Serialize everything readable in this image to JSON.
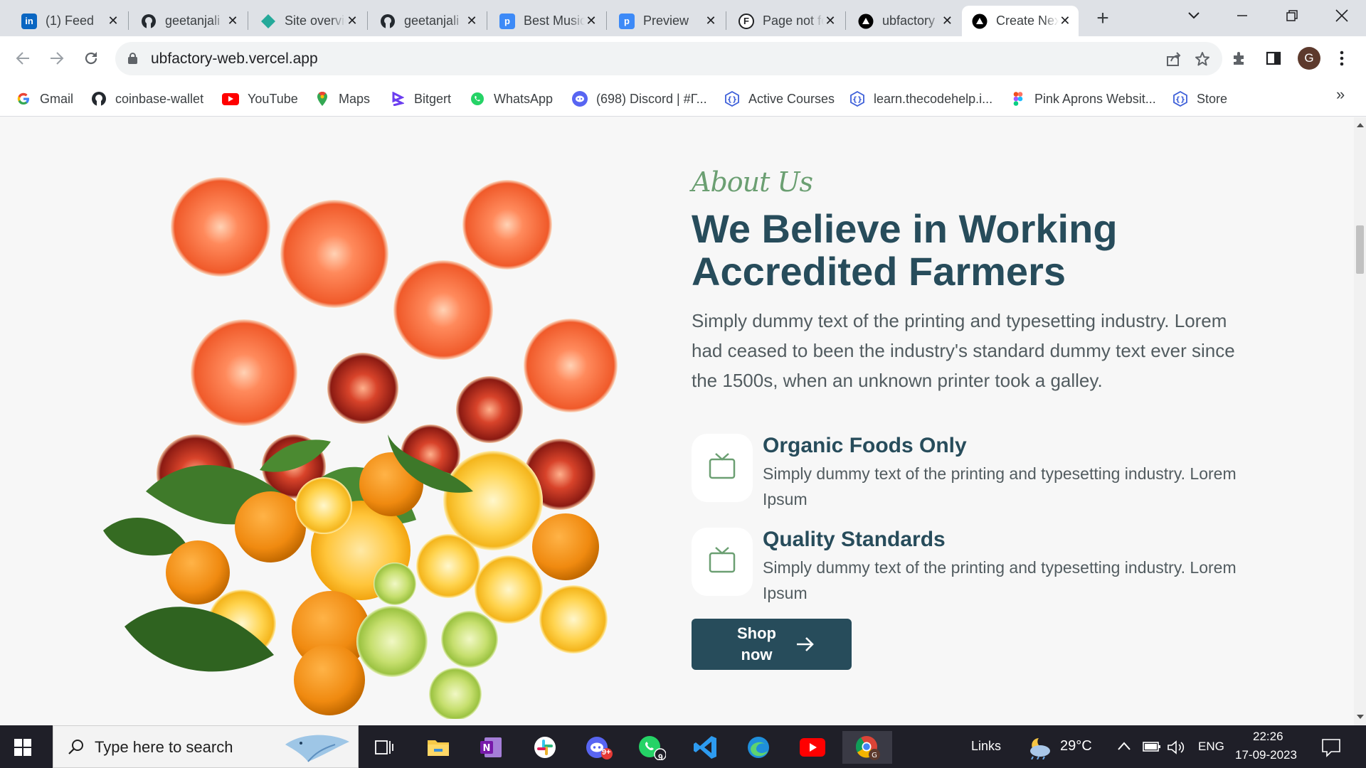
{
  "browser": {
    "tabs": [
      {
        "title": "(1) Feed",
        "favicon": "linkedin-icon",
        "color": "#0a66c2"
      },
      {
        "title": "geetanjali",
        "favicon": "github-icon",
        "color": "#24292f"
      },
      {
        "title": "Site overview",
        "favicon": "netlify-icon",
        "color": "#25a99a"
      },
      {
        "title": "geetanjali",
        "favicon": "github-icon",
        "color": "#24292f"
      },
      {
        "title": "Best Music",
        "favicon": "p-icon",
        "color": "#3d8af7"
      },
      {
        "title": "Preview",
        "favicon": "p-icon",
        "color": "#3d8af7"
      },
      {
        "title": "Page not found",
        "favicon": "f-circle-icon",
        "color": "#202124"
      },
      {
        "title": "ubfactory",
        "favicon": "vercel-icon",
        "color": "#000000"
      },
      {
        "title": "Create Next App",
        "favicon": "vercel-icon",
        "color": "#000000",
        "active": true
      }
    ],
    "url": "ubfactory-web.vercel.app",
    "profile_initial": "G",
    "bookmarks": [
      {
        "label": "Gmail",
        "icon": "google-icon"
      },
      {
        "label": "coinbase-wallet",
        "icon": "github-icon"
      },
      {
        "label": "YouTube",
        "icon": "youtube-icon"
      },
      {
        "label": "Maps",
        "icon": "maps-icon"
      },
      {
        "label": "Bitgert",
        "icon": "bitgert-icon"
      },
      {
        "label": "WhatsApp",
        "icon": "whatsapp-icon"
      },
      {
        "label": "(698) Discord | #Γ...",
        "icon": "discord-icon"
      },
      {
        "label": "Active Courses",
        "icon": "codehelp-icon"
      },
      {
        "label": "learn.thecodehelp.i...",
        "icon": "codehelp-icon"
      },
      {
        "label": "Pink Aprons Websit...",
        "icon": "figma-icon"
      },
      {
        "label": "Store",
        "icon": "codehelp-icon"
      }
    ]
  },
  "page": {
    "about_label": "About Us",
    "headline": "We Believe in Working Accredited Farmers",
    "lead": "Simply dummy text of the printing and typesetting industry. Lorem had ceased to been the industry's standard dummy text ever since the 1500s, when an unknown printer took a galley.",
    "features": [
      {
        "title": "Organic Foods Only",
        "description": "Simply dummy text of the printing and typesetting industry. Lorem Ipsum",
        "icon": "tv-icon"
      },
      {
        "title": "Quality Standards",
        "description": "Simply dummy text of the printing and typesetting industry. Lorem Ipsum",
        "icon": "tv-icon"
      }
    ],
    "cta_label": "Shop now",
    "accent_color": "#274c5b",
    "label_color": "#6b9f72"
  },
  "taskbar": {
    "search_placeholder": "Type here to search",
    "links_label": "Links",
    "temperature": "29°C",
    "language": "ENG",
    "time": "22:26",
    "date": "17-09-2023",
    "badges": {
      "discord": "9+",
      "whatsapp": "9"
    }
  }
}
